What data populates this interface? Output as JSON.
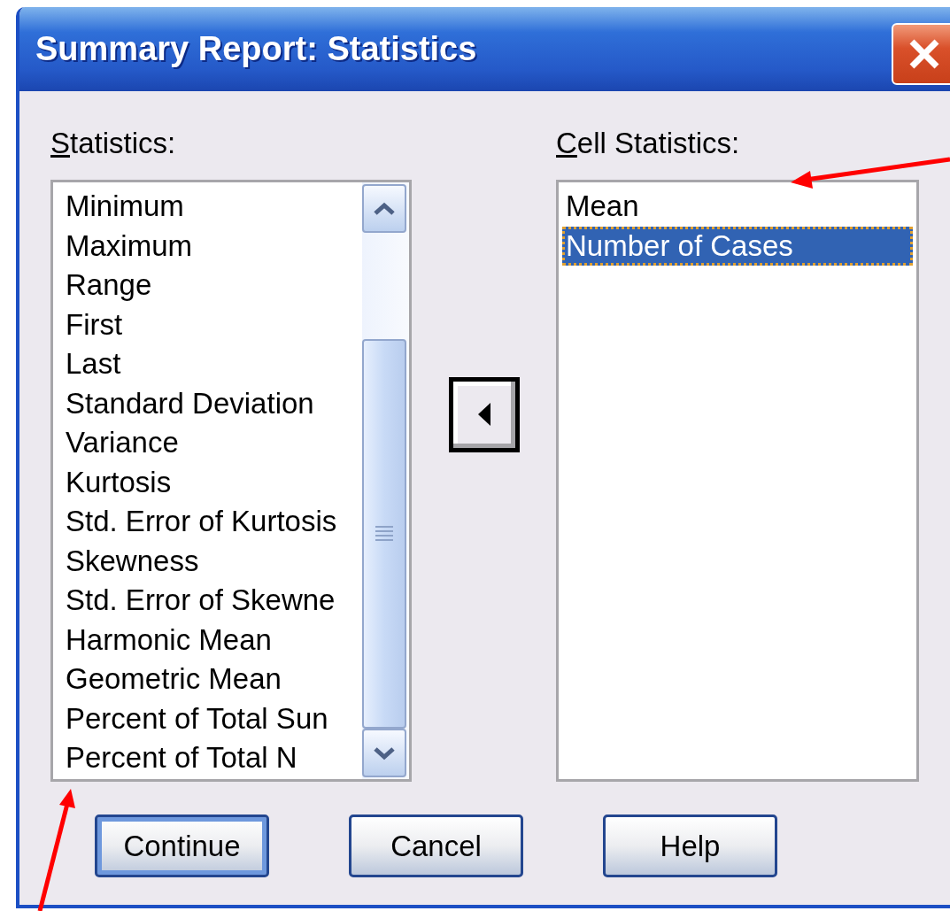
{
  "window": {
    "title": "Summary Report: Statistics"
  },
  "statistics": {
    "label": "Statistics:",
    "items": [
      {
        "text": "Minimum",
        "selected": false
      },
      {
        "text": "Maximum",
        "selected": false
      },
      {
        "text": "Range",
        "selected": false
      },
      {
        "text": "First",
        "selected": false
      },
      {
        "text": "Last",
        "selected": false
      },
      {
        "text": "Standard Deviation",
        "selected": false
      },
      {
        "text": "Variance",
        "selected": false
      },
      {
        "text": "Kurtosis",
        "selected": false
      },
      {
        "text": "Std. Error of Kurtosis",
        "selected": false
      },
      {
        "text": "Skewness",
        "selected": false
      },
      {
        "text": "Std. Error of Skewne",
        "selected": false
      },
      {
        "text": "Harmonic Mean",
        "selected": false
      },
      {
        "text": "Geometric Mean",
        "selected": false
      },
      {
        "text": "Percent of Total Sun",
        "selected": false
      },
      {
        "text": "Percent of Total N",
        "selected": false
      }
    ]
  },
  "cell_statistics": {
    "label": "Cell Statistics:",
    "items": [
      {
        "text": "Mean",
        "selected": false
      },
      {
        "text": "Number of Cases",
        "selected": true
      }
    ]
  },
  "buttons": [
    {
      "label": "Continue",
      "default": true
    },
    {
      "label": "Cancel",
      "default": false
    },
    {
      "label": "Help",
      "default": false
    }
  ]
}
